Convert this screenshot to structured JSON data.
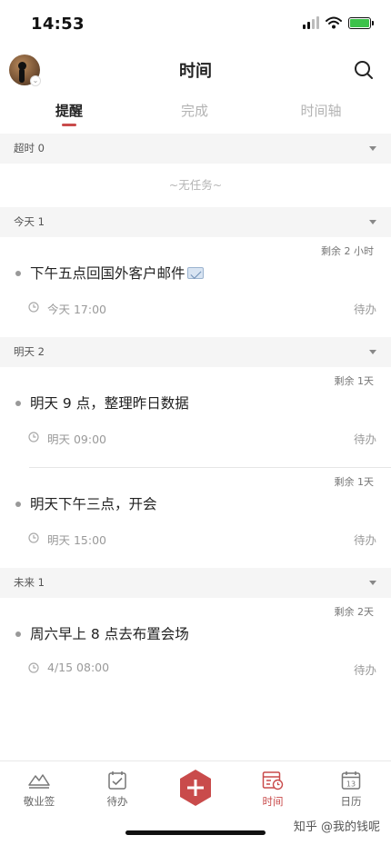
{
  "status_bar": {
    "time": "14:53"
  },
  "header": {
    "title": "时间"
  },
  "tabs": [
    {
      "label": "提醒",
      "active": true
    },
    {
      "label": "完成",
      "active": false
    },
    {
      "label": "时间轴",
      "active": false
    }
  ],
  "sections": {
    "overdue": {
      "label": "超时 0",
      "empty_text": "~无任务~"
    },
    "today": {
      "label": "今天 1",
      "tasks": [
        {
          "remain": "剩余 2 小时",
          "title": "下午五点回国外客户邮件",
          "icon": "envelope-icon",
          "time": "今天 17:00",
          "status": "待办"
        }
      ]
    },
    "tomorrow": {
      "label": "明天 2",
      "tasks": [
        {
          "remain": "剩余 1天",
          "title": "明天 9 点，整理昨日数据",
          "time": "明天 09:00",
          "status": "待办"
        },
        {
          "remain": "剩余 1天",
          "title": "明天下午三点，开会",
          "time": "明天 15:00",
          "status": "待办"
        }
      ]
    },
    "future": {
      "label": "未来 1",
      "tasks": [
        {
          "remain": "剩余 2天",
          "title": "周六早上 8 点去布置会场",
          "time": "4/15 08:00",
          "status": "待办"
        }
      ]
    }
  },
  "tabbar": {
    "items": [
      {
        "label": "敬业签",
        "icon": "sign-icon"
      },
      {
        "label": "待办",
        "icon": "checklist-icon"
      },
      {
        "label": "时间",
        "icon": "time-icon",
        "active": true
      },
      {
        "label": "日历",
        "icon": "calendar-icon",
        "day": "13"
      }
    ],
    "add_symbol": "+"
  },
  "watermark": "知乎 @我的钱呢",
  "colors": {
    "accent": "#c94b4b",
    "section_bg": "#f5f5f5",
    "muted_text": "#9a9a9a"
  }
}
